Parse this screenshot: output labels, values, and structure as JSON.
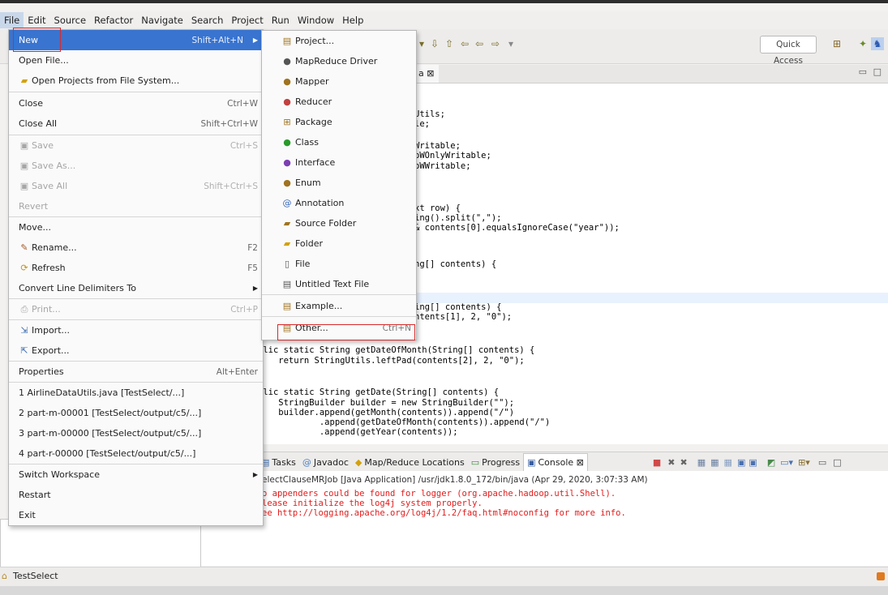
{
  "menubar": [
    "File",
    "Edit",
    "Source",
    "Refactor",
    "Navigate",
    "Search",
    "Project",
    "Run",
    "Window",
    "Help"
  ],
  "toolbar": {
    "quick_access": "Quick Access"
  },
  "editor": {
    "tab_label": "a ⊠",
    "lines": [
      {
        "t": "Utils;"
      },
      {
        "t": "le;"
      },
      {
        "t": "Writable;"
      },
      {
        "t": "oWOnlyWritable;"
      },
      {
        "t": "oWWritable;"
      },
      {
        "t": "xt row) {"
      },
      {
        "t": "ing().split(\",\");"
      },
      {
        "t": "& contents[0].equalsIgnoreCase(\"year\"));"
      },
      {
        "t": "ng[] contents) {"
      },
      {
        "t": "ing[] contents) {"
      },
      {
        "t": "ntents[1], 2, \"0\");"
      },
      {
        "t": "blic static String getDateOfMonth(String[] contents) {"
      },
      {
        "t": "    return StringUtils.leftPad(contents[2], 2, \"0\");"
      },
      {
        "t": "blic static String getDate(String[] contents) {"
      },
      {
        "t": "    StringBuilder builder = new StringBuilder(\"\");"
      },
      {
        "t": "    builder.append(getMonth(contents)).append(\"/\")"
      },
      {
        "t": "            .append(getDateOfMonth(contents)).append(\"/\")"
      },
      {
        "t": "            .append(getYear(contents));"
      }
    ]
  },
  "bottom_tabs": [
    "Tasks",
    "Javadoc",
    "Map/Reduce Locations",
    "Progress",
    "Console ⊠"
  ],
  "console": {
    "header": "electClauseMRJob [Java Application] /usr/jdk1.8.0_172/bin/java (Apr 29, 2020, 3:07:33 AM)",
    "lines": [
      "o appenders could be found for logger (org.apache.hadoop.util.Shell).",
      "lease initialize the log4j system properly.",
      "ee http://logging.apache.org/log4j/1.2/faq.html#noconfig for more info."
    ]
  },
  "statusbar": {
    "project": "TestSelect"
  },
  "file_menu": [
    {
      "label": "New",
      "shortcut": "Shift+Alt+N",
      "submenu": true,
      "selected": true
    },
    {
      "label": "Open File..."
    },
    {
      "label": "Open Projects from File System...",
      "icon": "folder-icon"
    },
    {
      "sep": true
    },
    {
      "label": "Close",
      "shortcut": "Ctrl+W"
    },
    {
      "label": "Close All",
      "shortcut": "Shift+Ctrl+W"
    },
    {
      "sep": true
    },
    {
      "label": "Save",
      "shortcut": "Ctrl+S",
      "disabled": true,
      "icon": "save-icon"
    },
    {
      "label": "Save As...",
      "disabled": true,
      "icon": "save-as-icon"
    },
    {
      "label": "Save All",
      "shortcut": "Shift+Ctrl+S",
      "disabled": true,
      "icon": "save-all-icon"
    },
    {
      "label": "Revert",
      "disabled": true
    },
    {
      "sep": true
    },
    {
      "label": "Move..."
    },
    {
      "label": "Rename...",
      "shortcut": "F2",
      "icon": "rename-icon"
    },
    {
      "label": "Refresh",
      "shortcut": "F5",
      "icon": "refresh-icon"
    },
    {
      "label": "Convert Line Delimiters To",
      "submenu": true
    },
    {
      "sep": true
    },
    {
      "label": "Print...",
      "shortcut": "Ctrl+P",
      "disabled": true,
      "icon": "print-icon"
    },
    {
      "sep": true
    },
    {
      "label": "Import...",
      "icon": "import-icon"
    },
    {
      "label": "Export...",
      "icon": "export-icon"
    },
    {
      "sep": true
    },
    {
      "label": "Properties",
      "shortcut": "Alt+Enter"
    },
    {
      "sep": true
    },
    {
      "label": "1 AirlineDataUtils.java  [TestSelect/...]"
    },
    {
      "label": "2 part-m-00001  [TestSelect/output/c5/...]"
    },
    {
      "label": "3 part-m-00000  [TestSelect/output/c5/...]"
    },
    {
      "label": "4 part-r-00000  [TestSelect/output/c5/...]"
    },
    {
      "sep": true
    },
    {
      "label": "Switch Workspace",
      "submenu": true
    },
    {
      "label": "Restart"
    },
    {
      "label": "Exit"
    }
  ],
  "new_submenu": [
    {
      "label": "Project...",
      "icon": "project-icon"
    },
    {
      "label": "MapReduce Driver",
      "icon": "mapreduce-driver-icon"
    },
    {
      "label": "Mapper",
      "icon": "mapper-icon"
    },
    {
      "label": "Reducer",
      "icon": "reducer-icon"
    },
    {
      "label": "Package",
      "icon": "package-icon"
    },
    {
      "label": "Class",
      "icon": "class-icon"
    },
    {
      "label": "Interface",
      "icon": "interface-icon"
    },
    {
      "label": "Enum",
      "icon": "enum-icon"
    },
    {
      "label": "Annotation",
      "icon": "annotation-icon"
    },
    {
      "label": "Source Folder",
      "icon": "source-folder-icon"
    },
    {
      "label": "Folder",
      "icon": "folder-icon"
    },
    {
      "label": "File",
      "icon": "file-icon"
    },
    {
      "label": "Untitled Text File",
      "icon": "text-file-icon"
    },
    {
      "sep": true
    },
    {
      "label": "Example...",
      "icon": "example-icon"
    },
    {
      "sep": true
    },
    {
      "label": "Other...",
      "shortcut": "Ctrl+N",
      "icon": "other-icon"
    }
  ]
}
